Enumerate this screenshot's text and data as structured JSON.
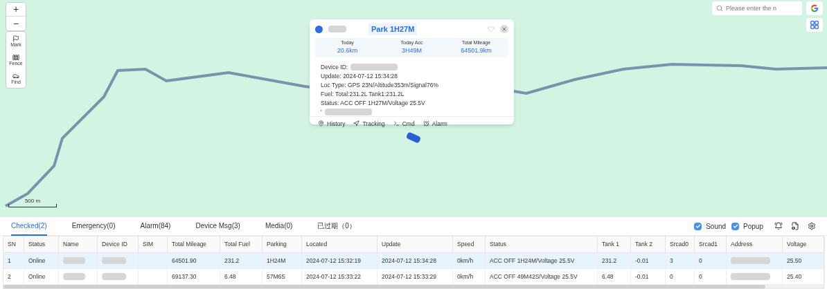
{
  "map_controls": {
    "zoom_in": "+",
    "zoom_out": "−",
    "tools": [
      {
        "kind": "flag",
        "label": "Mark"
      },
      {
        "kind": "fence",
        "label": "Fence"
      },
      {
        "kind": "find",
        "label": "Find"
      }
    ],
    "scale": "500 m"
  },
  "search": {
    "placeholder": "Please enter the n"
  },
  "popup": {
    "title": "Park 1H27M",
    "stats": [
      {
        "label": "Today",
        "value": "20.6km"
      },
      {
        "label": "Today Acc",
        "value": "3H49M"
      },
      {
        "label": "Total Mileage",
        "value": "64501.9km"
      }
    ],
    "lines": [
      {
        "kind": "masked",
        "label": "Device ID:"
      },
      {
        "kind": "text",
        "text": "Update: 2024-07-12 15:34:28"
      },
      {
        "kind": "text",
        "text": "Loc Type: GPS 23N/Altitude353m/Signal76%"
      },
      {
        "kind": "text",
        "text": "Fuel: Total:231.2L Tank1:231.2L"
      },
      {
        "kind": "text",
        "text": "Status: ACC OFF 1H27M/Voltage 25.5V"
      },
      {
        "kind": "masked",
        "label": "'"
      }
    ],
    "actions": [
      {
        "kind": "history",
        "label": "History"
      },
      {
        "kind": "tracking",
        "label": "Tracking"
      },
      {
        "kind": "cmd",
        "label": "Cmd"
      },
      {
        "kind": "alarm",
        "label": "Alarm"
      }
    ]
  },
  "tabs": [
    {
      "label": "Checked(2)",
      "selected": true
    },
    {
      "label": "Emergency(0)",
      "selected": false
    },
    {
      "label": "Alarm(84)",
      "selected": false
    },
    {
      "label": "Device Msg(3)",
      "selected": false
    },
    {
      "label": "Media(0)",
      "selected": false
    },
    {
      "label": "已过期（0）",
      "selected": false
    }
  ],
  "options": [
    {
      "label": "Sound",
      "checked": true
    },
    {
      "label": "Popup",
      "checked": true
    }
  ],
  "table": {
    "columns": [
      "SN",
      "Status",
      "Name",
      "Device ID",
      "SIM",
      "Total Mileage",
      "Total Fuel",
      "Parking",
      "Located",
      "Update",
      "Speed",
      "Status",
      "Tank 1",
      "Tank 2",
      "Srcad0",
      "Srcad1",
      "Address",
      "Voltage"
    ],
    "rows": [
      {
        "selected": true,
        "cells": [
          "1",
          "Online",
          {
            "masked": true
          },
          {
            "masked": true
          },
          null,
          "64501.90",
          "231.2",
          "1H24M",
          "2024-07-12 15:32:19",
          "2024-07-12 15:34:28",
          "0km/h",
          "ACC OFF 1H24M/Voltage 25.5V",
          "231.2",
          "-0.01",
          "3",
          "0",
          {
            "masked": true
          },
          "25.50"
        ]
      },
      {
        "selected": false,
        "cells": [
          "2",
          "Online",
          {
            "masked": true
          },
          {
            "masked": true
          },
          null,
          "69137.30",
          "6.48",
          "57M6S",
          "2024-07-12 15:33:22",
          "2024-07-12 15:33:29",
          "0km/h",
          "ACC OFF 49M42S/Voltage 25.5V",
          "6.48",
          "-0.01",
          "0",
          "0",
          {
            "masked": true
          },
          "25.40"
        ]
      }
    ]
  }
}
